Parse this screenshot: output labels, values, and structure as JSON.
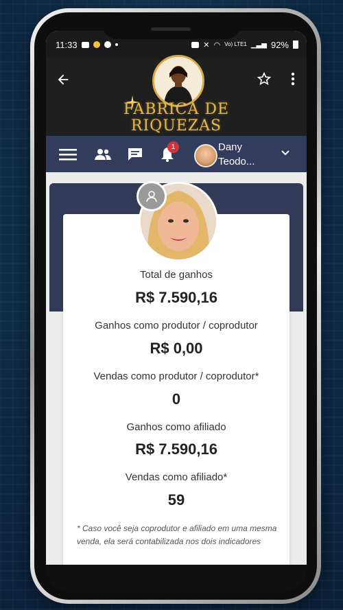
{
  "status": {
    "time": "11:33",
    "network": "Vo) LTE1",
    "battery": "92%"
  },
  "header": {
    "brand_line1": "FABRICA DE",
    "brand_line2": "RIQUEZAS"
  },
  "toolbar": {
    "notification_count": "1",
    "user_name_line1": "Dany",
    "user_name_line2": "Teodo..."
  },
  "stats": [
    {
      "label": "Total de ganhos",
      "value": "R$ 7.590,16"
    },
    {
      "label": "Ganhos como produtor / coprodutor",
      "value": "R$ 0,00"
    },
    {
      "label": "Vendas como produtor / coprodutor*",
      "value": "0"
    },
    {
      "label": "Ganhos como afiliado",
      "value": "R$ 7.590,16"
    },
    {
      "label": "Vendas como afiliado*",
      "value": "59"
    }
  ],
  "footnote": "* Caso você seja coprodutor e afiliado em uma mesma venda, ela será contabilizada nos dois indicadores",
  "colors": {
    "toolbar_bg": "#323c5c",
    "brand_gold": "#e4b84c",
    "badge_red": "#d8313a"
  },
  "icons": [
    "back-arrow-icon",
    "star-icon",
    "more-vert-icon",
    "menu-icon",
    "people-icon",
    "chat-icon",
    "bell-icon",
    "chevron-down-icon",
    "change-photo-icon"
  ]
}
